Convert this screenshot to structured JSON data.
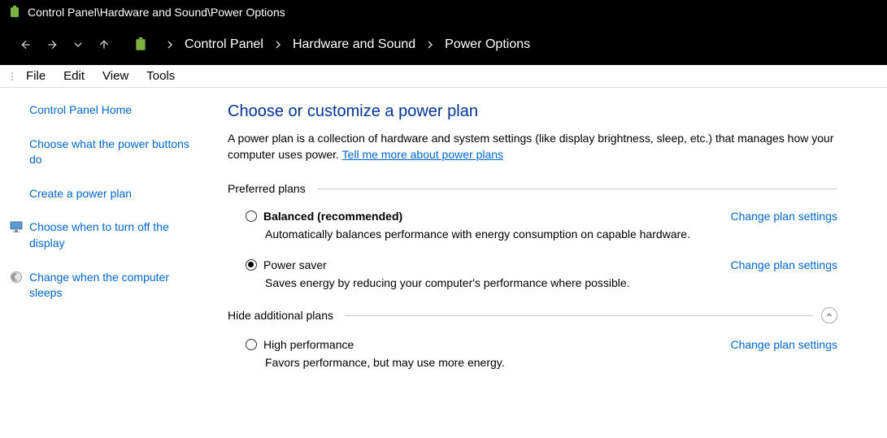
{
  "titlebar": {
    "path": "Control Panel\\Hardware and Sound\\Power Options"
  },
  "breadcrumb": {
    "items": [
      "Control Panel",
      "Hardware and Sound",
      "Power Options"
    ]
  },
  "menubar": {
    "items": [
      "File",
      "Edit",
      "View",
      "Tools"
    ]
  },
  "sidebar": {
    "links": [
      {
        "label": "Control Panel Home",
        "icon": null
      },
      {
        "label": "Choose what the power buttons do",
        "icon": null
      },
      {
        "label": "Create a power plan",
        "icon": null
      },
      {
        "label": "Choose when to turn off the display",
        "icon": "monitor"
      },
      {
        "label": "Change when the computer sleeps",
        "icon": "moon"
      }
    ]
  },
  "main": {
    "heading": "Choose or customize a power plan",
    "description": "A power plan is a collection of hardware and system settings (like display brightness, sleep, etc.) that manages how your computer uses power. ",
    "more_link": "Tell me more about power plans",
    "preferred_label": "Preferred plans",
    "hide_label": "Hide additional plans",
    "change_link": "Change plan settings",
    "plans": {
      "preferred": [
        {
          "title": "Balanced (recommended)",
          "bold": true,
          "selected": false,
          "desc": "Automatically balances performance with energy consumption on capable hardware."
        },
        {
          "title": "Power saver",
          "bold": false,
          "selected": true,
          "desc": "Saves energy by reducing your computer's performance where possible."
        }
      ],
      "additional": [
        {
          "title": "High performance",
          "bold": false,
          "selected": false,
          "desc": "Favors performance, but may use more energy."
        }
      ]
    }
  }
}
